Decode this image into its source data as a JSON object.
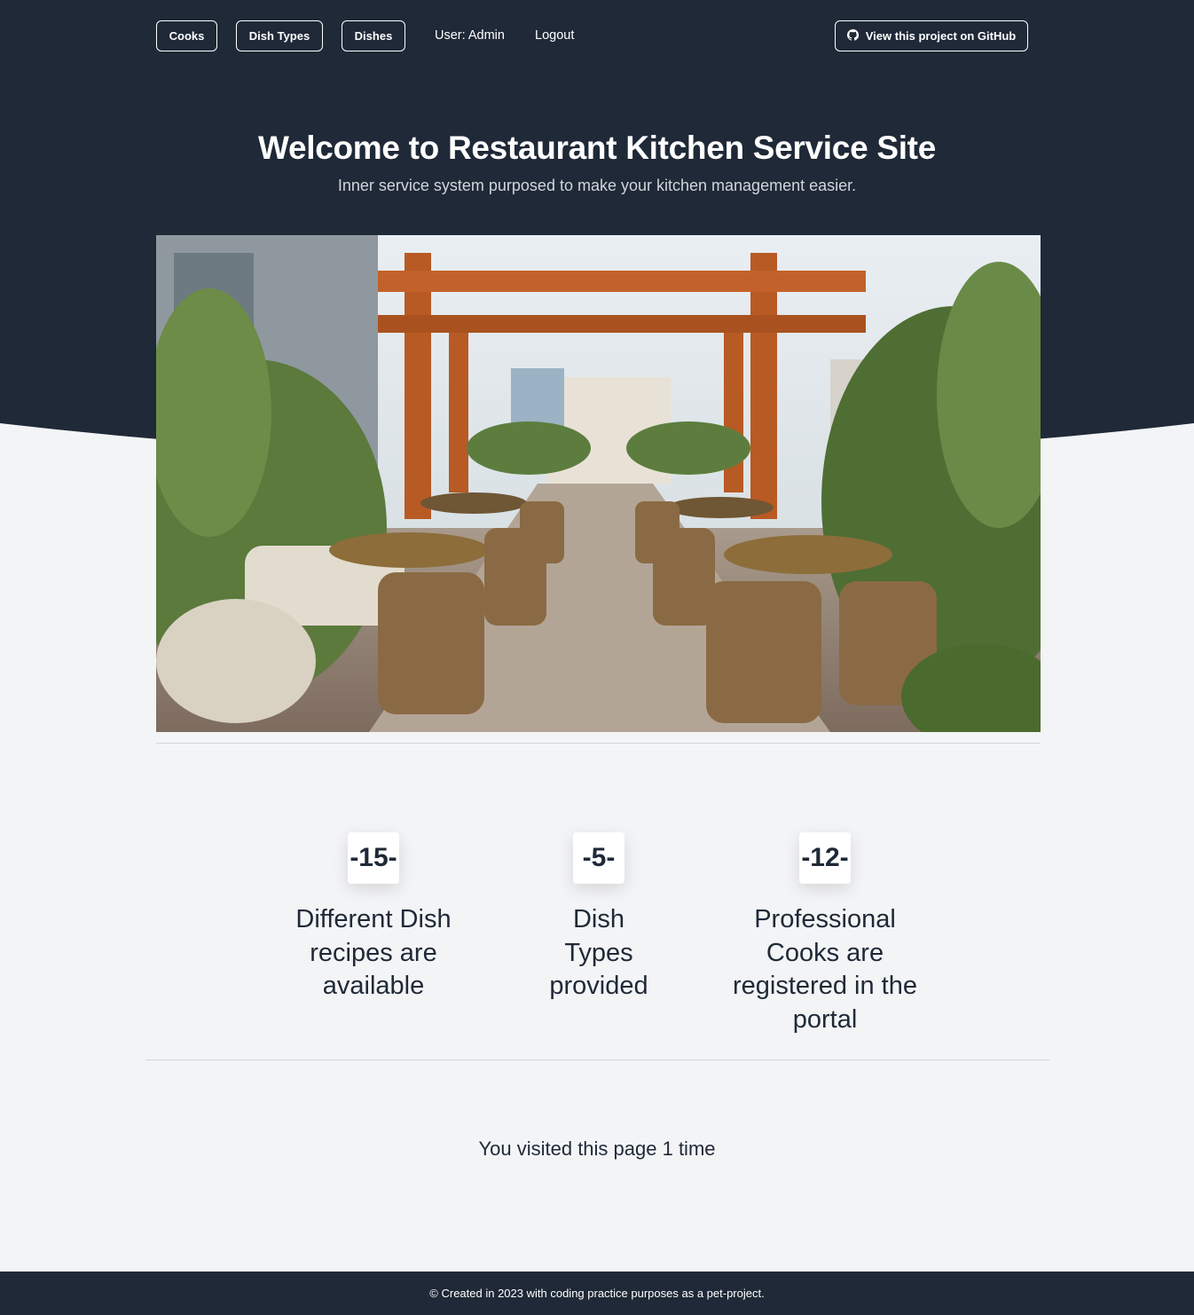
{
  "nav": {
    "cooks": "Cooks",
    "dish_types": "Dish Types",
    "dishes": "Dishes",
    "user": "User: Admin",
    "logout": "Logout",
    "github": "View this project on GitHub"
  },
  "hero": {
    "title": "Welcome to Restaurant Kitchen Service Site",
    "subtitle": "Inner service system purposed to make your kitchen management easier."
  },
  "stats": [
    {
      "value": "-15-",
      "label": "Different Dish recipes are available"
    },
    {
      "value": "-5-",
      "label": "Dish Types provided"
    },
    {
      "value": "-12-",
      "label": "Professional Cooks are registered in the portal"
    }
  ],
  "visits": "You visited this page 1 time",
  "footer": "© Created in 2023 with coding practice purposes as a pet-project.",
  "colors": {
    "dark": "#1f2937",
    "page_bg": "#f3f4f6"
  },
  "icons": {
    "github": "github-icon"
  }
}
